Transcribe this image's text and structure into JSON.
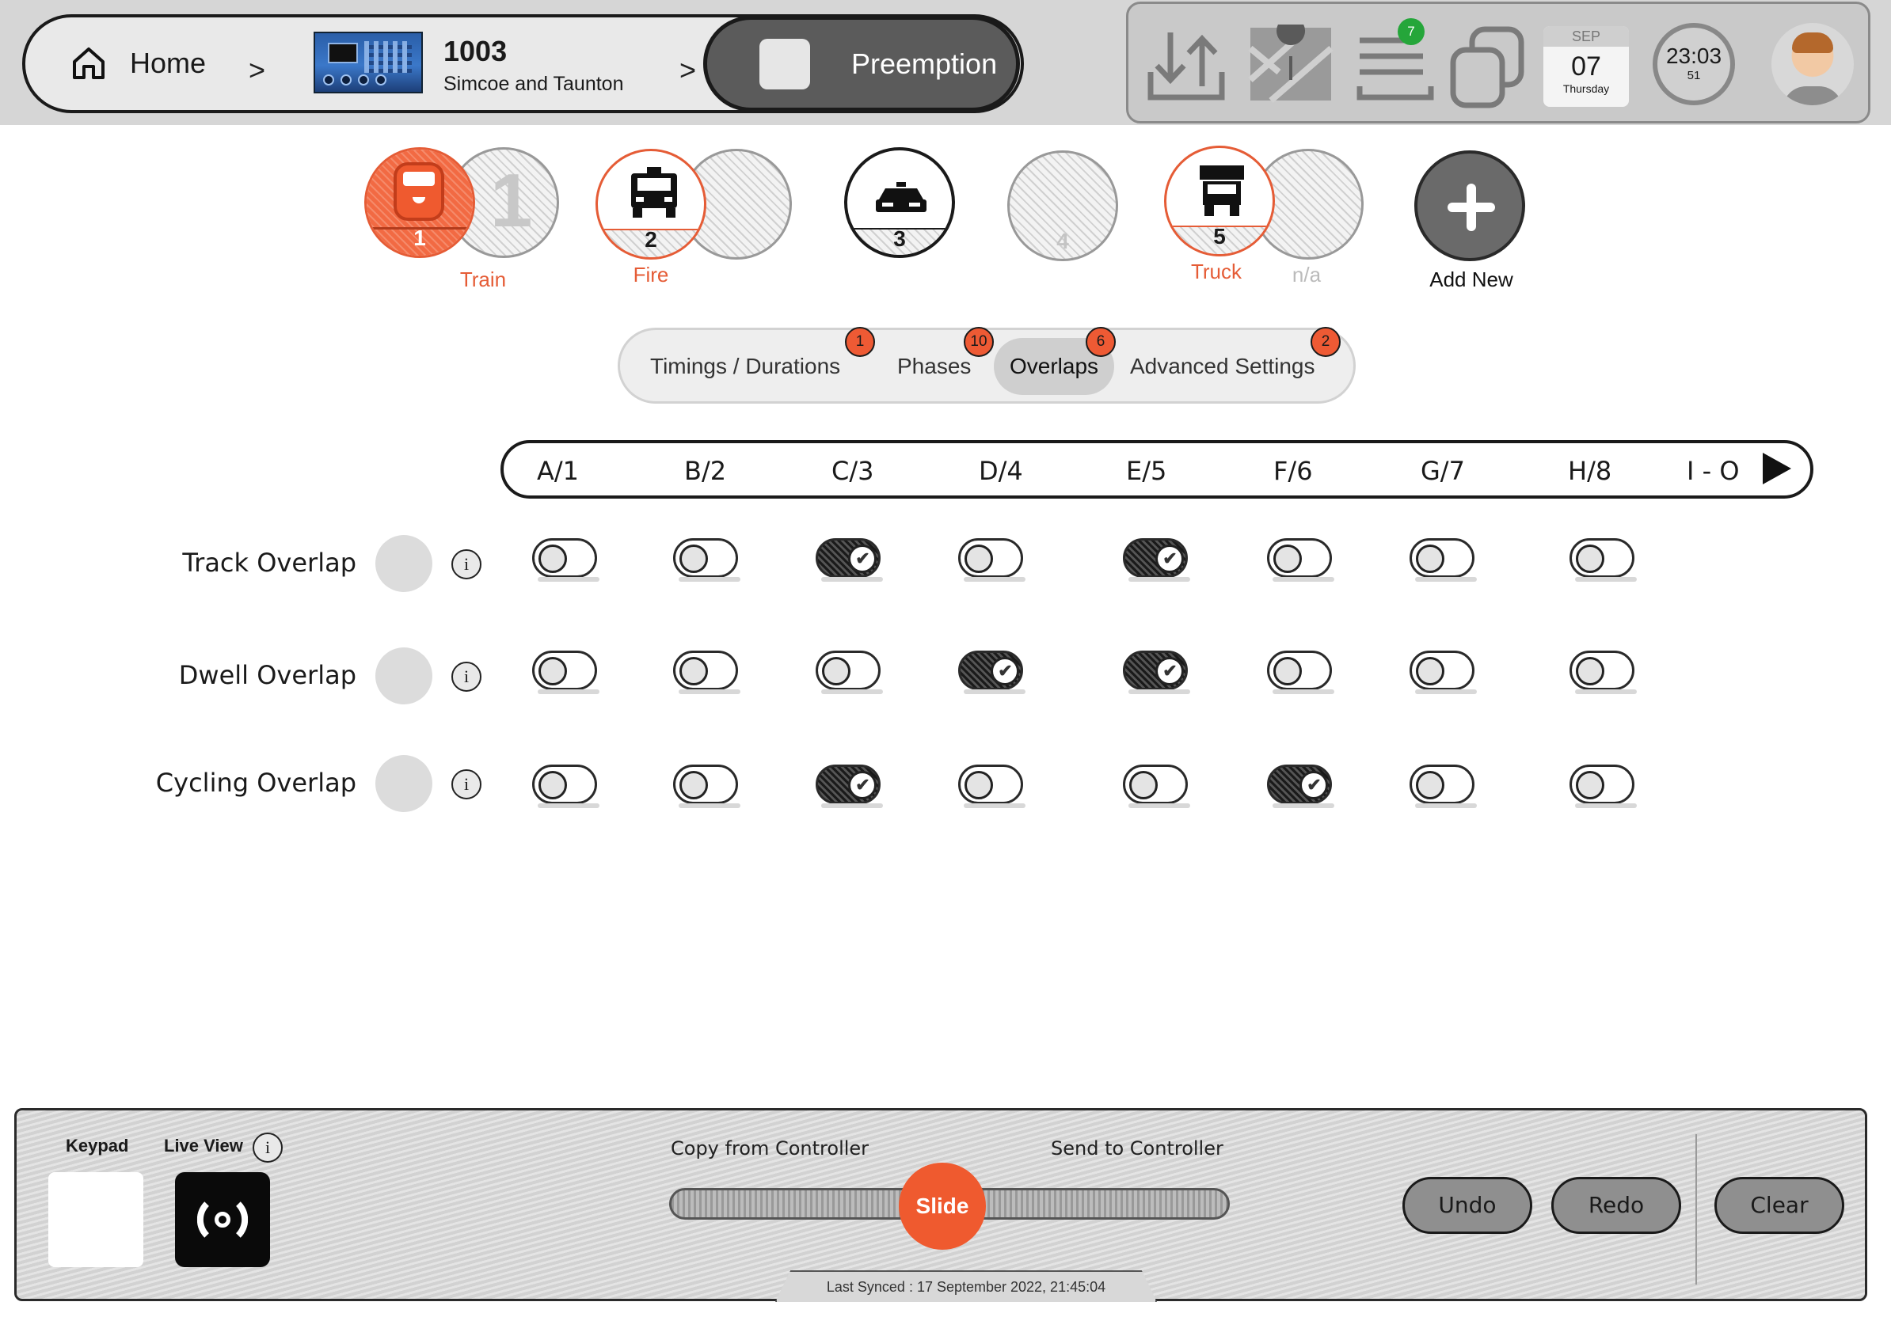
{
  "breadcrumb": {
    "home_label": "Home",
    "device_id": "1003",
    "device_name": "Simcoe and Taunton",
    "current_label": "Preemption"
  },
  "toolbar": {
    "notifications_count": "7",
    "date_month": "SEP",
    "date_day": "07",
    "date_weekday": "Thursday",
    "clock_time": "23:03",
    "clock_seconds": "51",
    "icons": [
      "download-upload-icon",
      "map-icon",
      "list-icon",
      "copy-icon",
      "calendar-icon",
      "clock-icon",
      "avatar"
    ]
  },
  "preemptions": [
    {
      "number": "1",
      "label": "Train",
      "ghost_number": "1",
      "state": "selected"
    },
    {
      "number": "2",
      "label": "Fire",
      "state": "active"
    },
    {
      "number": "3",
      "label": "",
      "state": "outlined"
    },
    {
      "number": "4",
      "label": "",
      "state": "disabled"
    },
    {
      "number": "5",
      "label": "Truck",
      "secondary_label": "n/a",
      "state": "active"
    }
  ],
  "add_new_label": "Add New",
  "tabs": [
    {
      "label": "Timings / Durations",
      "badge": "1"
    },
    {
      "label": "Phases",
      "badge": "10"
    },
    {
      "label": "Overlaps",
      "badge": "6",
      "active": true
    },
    {
      "label": "Advanced Settings",
      "badge": "2"
    }
  ],
  "phases": [
    "A/1",
    "B/2",
    "C/3",
    "D/4",
    "E/5",
    "F/6",
    "G/7",
    "H/8",
    "I - O"
  ],
  "rows": [
    {
      "label": "Track Overlap",
      "values": [
        false,
        false,
        true,
        false,
        true,
        false,
        false,
        false
      ]
    },
    {
      "label": "Dwell Overlap",
      "values": [
        false,
        false,
        false,
        true,
        true,
        false,
        false,
        false
      ]
    },
    {
      "label": "Cycling Overlap",
      "values": [
        false,
        false,
        true,
        false,
        false,
        true,
        false,
        false
      ]
    }
  ],
  "bottom": {
    "keypad_label": "Keypad",
    "liveview_label": "Live View",
    "copy_label": "Copy from Controller",
    "send_label": "Send to Controller",
    "slide_label": "Slide",
    "undo_label": "Undo",
    "redo_label": "Redo",
    "clear_label": "Clear",
    "last_synced": "Last Synced : 17 September 2022, 21:45:04"
  },
  "colors": {
    "accent": "#ef5a2f",
    "badge_green": "#25a63a",
    "dark": "#1a1a1a"
  }
}
